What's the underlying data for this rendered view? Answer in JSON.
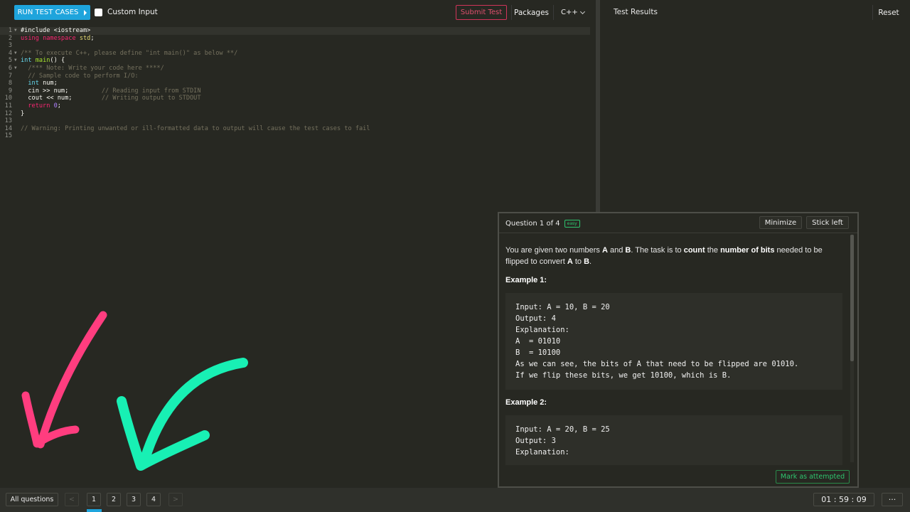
{
  "toolbar": {
    "run_label": "RUN TEST CASES",
    "custom_input_label": "Custom Input",
    "submit_label": "Submit Test",
    "packages_label": "Packages",
    "language": "C++"
  },
  "editor": {
    "line_numbers": [
      "1",
      "2",
      "3",
      "4",
      "5",
      "6",
      "7",
      "8",
      "9",
      "10",
      "11",
      "12",
      "13",
      "14",
      "15"
    ]
  },
  "results": {
    "title": "Test Results",
    "reset_label": "Reset"
  },
  "question": {
    "title": "Question 1 of 4",
    "difficulty": "easy",
    "minimize_label": "Minimize",
    "stick_left_label": "Stick left",
    "example1_title": "Example 1:",
    "example1_text": "Input: A = 10, B = 20\nOutput: 4\nExplanation:\nA  = 01010\nB  = 10100\nAs we can see, the bits of A that need to be flipped are 01010.\nIf we flip these bits, we get 10100, which is B.",
    "example2_title": "Example 2:",
    "example2_text": "Input: A = 20, B = 25\nOutput: 3\nExplanation:",
    "mark_label": "Mark as attempted"
  },
  "bottom": {
    "all_questions_label": "All questions",
    "prev": "<",
    "next": ">",
    "pages": [
      "1",
      "2",
      "3",
      "4"
    ],
    "timer": "01 : 59 : 09",
    "more": "···"
  },
  "colors": {
    "accent": "#1ea4dc",
    "submit": "#d0345a",
    "easy": "#2ec46e",
    "annotation_pink": "#ff3d7f",
    "annotation_green": "#18f0b4"
  }
}
